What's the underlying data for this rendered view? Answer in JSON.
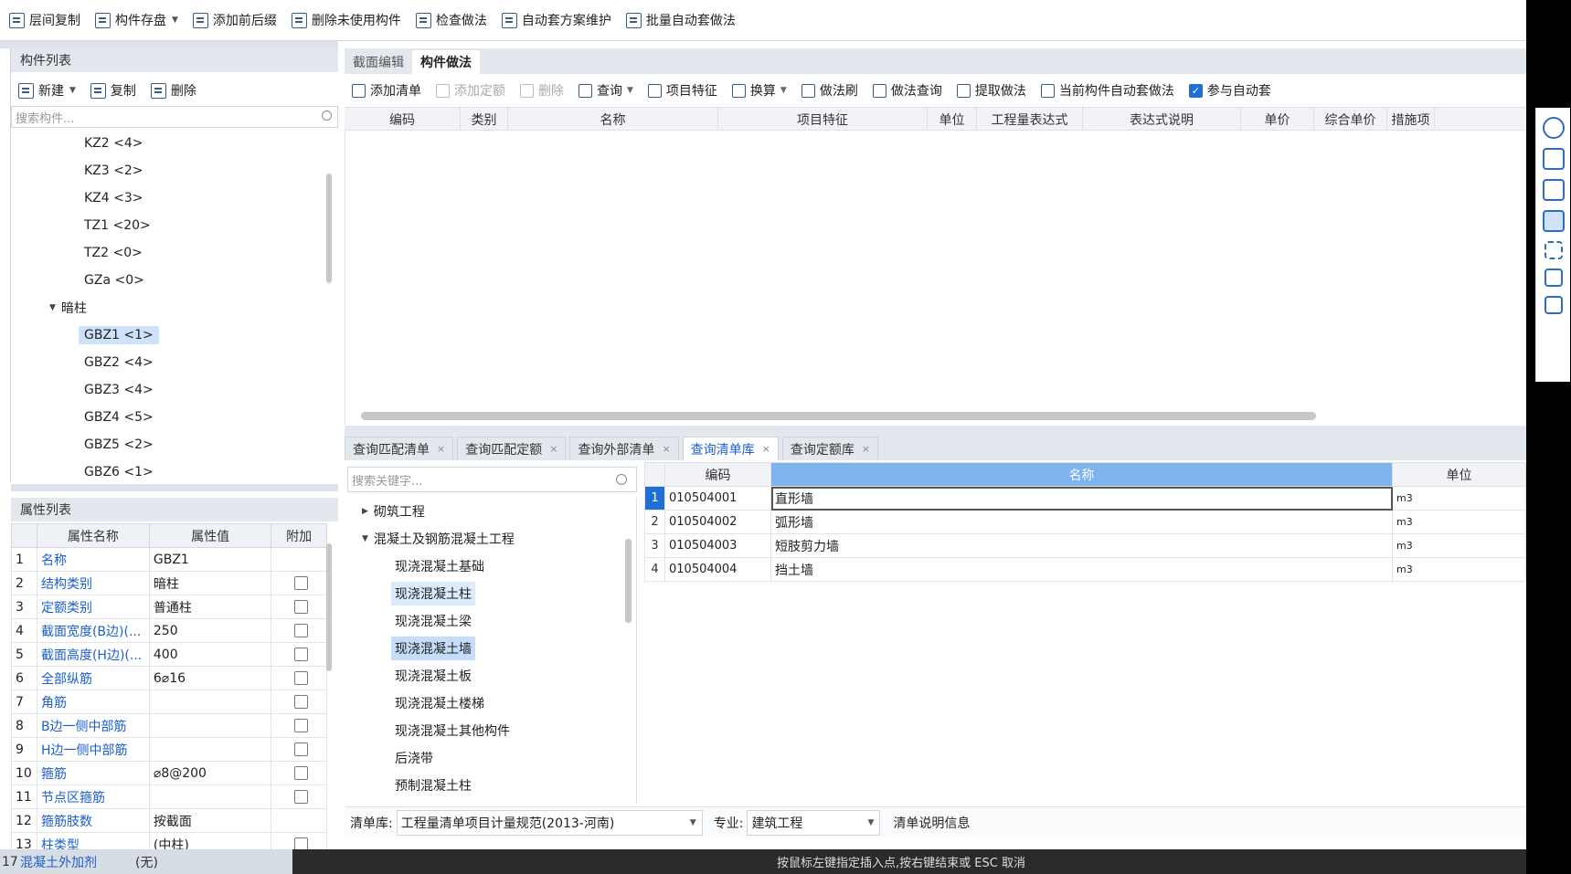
{
  "toolbar": {
    "items": [
      {
        "label": "层间复制",
        "dropdown": false
      },
      {
        "label": "构件存盘",
        "dropdown": true
      },
      {
        "label": "添加前后缀",
        "dropdown": false
      },
      {
        "label": "删除未使用构件",
        "dropdown": false
      },
      {
        "label": "检查做法",
        "dropdown": false
      },
      {
        "label": "自动套方案维护",
        "dropdown": false
      },
      {
        "label": "批量自动套做法",
        "dropdown": false
      }
    ]
  },
  "component_list": {
    "title": "构件列表",
    "actions": {
      "new": "新建",
      "copy": "复制",
      "delete": "删除"
    },
    "search_placeholder": "搜索构件...",
    "items": [
      {
        "label": "KZ2 <4>",
        "level": 2
      },
      {
        "label": "KZ3 <2>",
        "level": 2
      },
      {
        "label": "KZ4 <3>",
        "level": 2
      },
      {
        "label": "TZ1 <20>",
        "level": 2
      },
      {
        "label": "TZ2 <0>",
        "level": 2
      },
      {
        "label": "GZa <0>",
        "level": 2
      },
      {
        "label": "暗柱",
        "level": 1
      },
      {
        "label": "GBZ1 <1>",
        "level": 2,
        "selected": true
      },
      {
        "label": "GBZ2 <4>",
        "level": 2
      },
      {
        "label": "GBZ3 <4>",
        "level": 2
      },
      {
        "label": "GBZ4 <5>",
        "level": 2
      },
      {
        "label": "GBZ5 <2>",
        "level": 2
      },
      {
        "label": "GBZ6 <1>",
        "level": 2
      }
    ]
  },
  "property_list": {
    "title": "属性列表",
    "headers": [
      "属性名称",
      "属性值",
      "附加"
    ],
    "rows": [
      {
        "num": "1",
        "name": "名称",
        "value": "GBZ1",
        "check": false
      },
      {
        "num": "2",
        "name": "结构类别",
        "value": "暗柱",
        "check": true
      },
      {
        "num": "3",
        "name": "定额类别",
        "value": "普通柱",
        "check": true
      },
      {
        "num": "4",
        "name": "截面宽度(B边)(...",
        "value": "250",
        "check": true
      },
      {
        "num": "5",
        "name": "截面高度(H边)(...",
        "value": "400",
        "check": true
      },
      {
        "num": "6",
        "name": "全部纵筋",
        "value": "6⌀16",
        "check": true
      },
      {
        "num": "7",
        "name": "角筋",
        "value": "",
        "check": true
      },
      {
        "num": "8",
        "name": "B边一侧中部筋",
        "value": "",
        "check": true
      },
      {
        "num": "9",
        "name": "H边一侧中部筋",
        "value": "",
        "check": true
      },
      {
        "num": "10",
        "name": "箍筋",
        "value": "⌀8@200",
        "check": true
      },
      {
        "num": "11",
        "name": "节点区箍筋",
        "value": "",
        "check": true
      },
      {
        "num": "12",
        "name": "箍筋肢数",
        "value": "按截面",
        "check": false
      },
      {
        "num": "13",
        "name": "柱类型",
        "value": "(中柱)",
        "check": true
      }
    ]
  },
  "status": {
    "left_num": "17",
    "left_name": "混凝土外加剂",
    "left_value": "(无)",
    "message": "按鼠标左键指定插入点,按右键结束或 ESC 取消"
  },
  "main_tabs": [
    {
      "label": "截面编辑",
      "active": false
    },
    {
      "label": "构件做法",
      "active": true
    }
  ],
  "method_toolbar": [
    {
      "label": "添加清单",
      "disabled": false,
      "dropdown": false
    },
    {
      "label": "添加定额",
      "disabled": true,
      "dropdown": false
    },
    {
      "label": "删除",
      "disabled": true,
      "dropdown": false
    },
    {
      "label": "查询",
      "disabled": false,
      "dropdown": true
    },
    {
      "label": "项目特征",
      "disabled": false,
      "dropdown": false
    },
    {
      "label": "换算",
      "disabled": false,
      "dropdown": true
    },
    {
      "label": "做法刷",
      "disabled": false,
      "dropdown": false
    },
    {
      "label": "做法查询",
      "disabled": false,
      "dropdown": false
    },
    {
      "label": "提取做法",
      "disabled": false,
      "dropdown": false
    },
    {
      "label": "当前构件自动套做法",
      "disabled": false,
      "dropdown": false
    }
  ],
  "auto_apply": {
    "label": "参与自动套",
    "checked": true
  },
  "method_columns": [
    "编码",
    "类别",
    "名称",
    "项目特征",
    "单位",
    "工程量表达式",
    "表达式说明",
    "单价",
    "综合单价",
    "措施项"
  ],
  "query_tabs": [
    {
      "label": "查询匹配清单",
      "active": false
    },
    {
      "label": "查询匹配定额",
      "active": false
    },
    {
      "label": "查询外部清单",
      "active": false
    },
    {
      "label": "查询清单库",
      "active": true
    },
    {
      "label": "查询定额库",
      "active": false
    }
  ],
  "library": {
    "search_placeholder": "搜索关键字...",
    "tree": [
      {
        "label": "砌筑工程",
        "level": 0,
        "toggle": "collapsed"
      },
      {
        "label": "混凝土及钢筋混凝土工程",
        "level": 0,
        "toggle": "expanded"
      },
      {
        "label": "现浇混凝土基础",
        "level": 1
      },
      {
        "label": "现浇混凝土柱",
        "level": 1,
        "state": "hover"
      },
      {
        "label": "现浇混凝土梁",
        "level": 1
      },
      {
        "label": "现浇混凝土墙",
        "level": 1,
        "state": "selected"
      },
      {
        "label": "现浇混凝土板",
        "level": 1
      },
      {
        "label": "现浇混凝土楼梯",
        "level": 1
      },
      {
        "label": "现浇混凝土其他构件",
        "level": 1
      },
      {
        "label": "后浇带",
        "level": 1
      },
      {
        "label": "预制混凝土柱",
        "level": 1
      }
    ],
    "columns": [
      "编码",
      "名称",
      "单位"
    ],
    "rows": [
      {
        "num": "1",
        "code": "010504001",
        "name": "直形墙",
        "unit": "m3"
      },
      {
        "num": "2",
        "code": "010504002",
        "name": "弧形墙",
        "unit": "m3"
      },
      {
        "num": "3",
        "code": "010504003",
        "name": "短肢剪力墙",
        "unit": "m3"
      },
      {
        "num": "4",
        "code": "010504004",
        "name": "挡土墙",
        "unit": "m3"
      }
    ]
  },
  "bottom_bar": {
    "lib_label": "清单库:",
    "lib_value": "工程量清单项目计量规范(2013-河南)",
    "major_label": "专业:",
    "major_value": "建筑工程",
    "info_label": "清单说明信息"
  }
}
